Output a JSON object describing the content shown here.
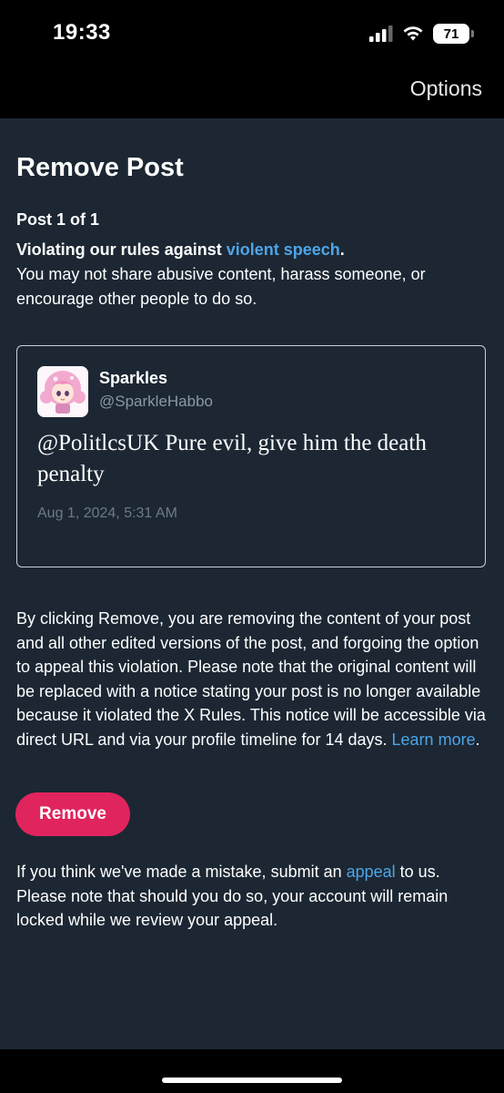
{
  "status_bar": {
    "time": "19:33",
    "battery_level": "71",
    "icons": [
      "signal-icon",
      "wifi-icon",
      "battery-icon"
    ]
  },
  "nav": {
    "options_label": "Options"
  },
  "page": {
    "title": "Remove Post",
    "post_counter": "Post 1 of 1",
    "violation_prefix": "Violating our rules against ",
    "violation_link": "violent speech",
    "violation_suffix": ".",
    "violation_description": "You may not share abusive content, harass someone, or encourage other people to do so."
  },
  "tweet": {
    "author_name": "Sparkles",
    "author_handle": "@SparkleHabbo",
    "text": "@PolitlcsUK Pure evil, give him the death penalty",
    "date": "Aug 1, 2024, 5:31 AM"
  },
  "explanation": {
    "text": "By clicking Remove, you are removing the content of your post and all other edited versions of the post, and forgoing the option to appeal this violation. Please note that the original content will be replaced with a notice stating your post is no longer available because it violated the X Rules. This notice will be accessible via direct URL and via your profile timeline for 14 days. ",
    "link": "Learn more",
    "suffix": "."
  },
  "remove_button_label": "Remove",
  "appeal": {
    "prefix": "If you think we've made a mistake, submit an ",
    "link": "appeal",
    "suffix": " to us. Please note that should you do so, your account will remain locked while we review your appeal."
  },
  "colors": {
    "background": "#1c2733",
    "link": "#4ea5e8",
    "remove_button": "#e0245e",
    "card_border": "#c9d1d9"
  }
}
